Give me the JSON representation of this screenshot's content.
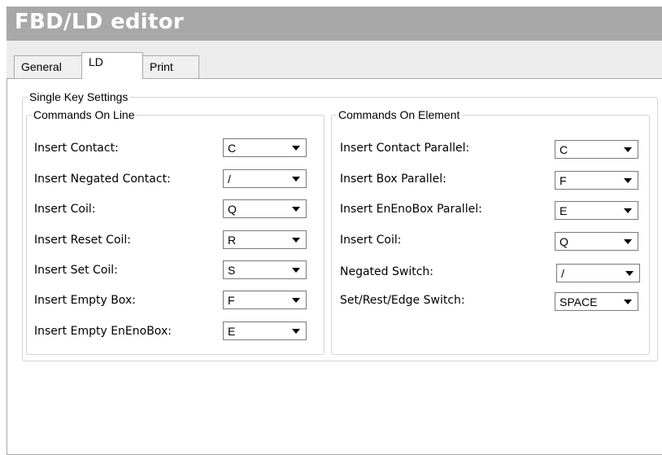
{
  "window": {
    "title": "FBD/LD editor"
  },
  "tabs": [
    {
      "label": "General"
    },
    {
      "label": "LD"
    },
    {
      "label": "Print"
    }
  ],
  "single_key_settings": {
    "legend": "Single Key Settings",
    "on_line": {
      "legend": "Commands On Line",
      "items": [
        {
          "label": "Insert Contact:",
          "value": "C"
        },
        {
          "label": "Insert Negated Contact:",
          "value": "/"
        },
        {
          "label": "Insert Coil:",
          "value": "Q"
        },
        {
          "label": "Insert Reset Coil:",
          "value": "R"
        },
        {
          "label": "Insert Set Coil:",
          "value": "S"
        },
        {
          "label": "Insert Empty Box:",
          "value": "F"
        },
        {
          "label": "Insert Empty EnEnoBox:",
          "value": "E"
        }
      ]
    },
    "on_element": {
      "legend": "Commands On Element",
      "items": [
        {
          "label": "Insert Contact Parallel:",
          "value": "C"
        },
        {
          "label": "Insert Box Parallel:",
          "value": "F"
        },
        {
          "label": "Insert EnEnoBox Parallel:",
          "value": "E"
        },
        {
          "label": "Insert Coil:",
          "value": "Q"
        },
        {
          "label": "Negated Switch:",
          "value": "/"
        },
        {
          "label": "Set/Rest/Edge Switch:",
          "value": "SPACE"
        }
      ]
    }
  }
}
